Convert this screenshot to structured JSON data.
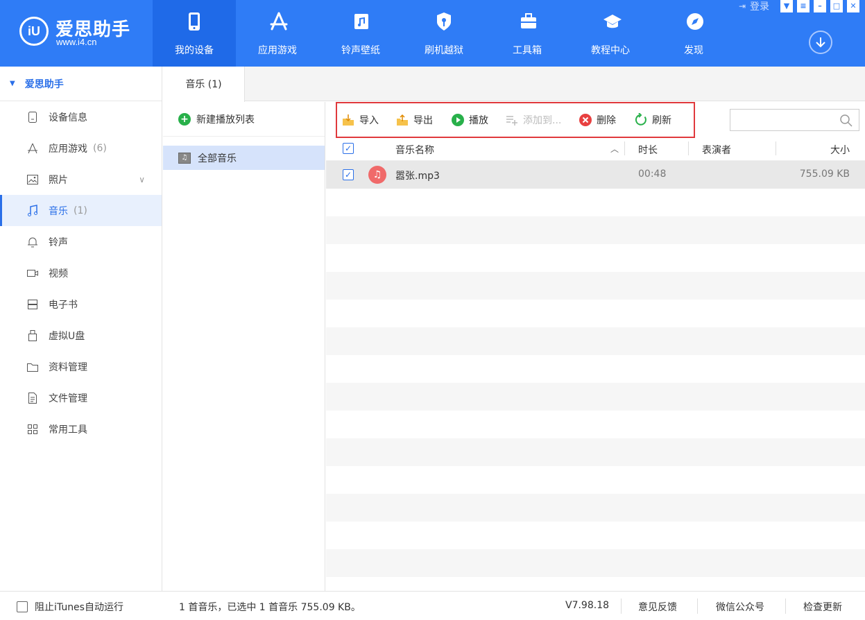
{
  "app": {
    "logo_mark": "iU",
    "logo_name": "爱思助手",
    "logo_url": "www.i4.cn",
    "login_label": "登录"
  },
  "nav": [
    {
      "label": "我的设备",
      "icon": "phone-icon",
      "active": true
    },
    {
      "label": "应用游戏",
      "icon": "app-store-icon"
    },
    {
      "label": "铃声壁纸",
      "icon": "music-file-icon"
    },
    {
      "label": "刷机越狱",
      "icon": "shield-key-icon"
    },
    {
      "label": "工具箱",
      "icon": "toolbox-icon"
    },
    {
      "label": "教程中心",
      "icon": "graduation-cap-icon"
    },
    {
      "label": "发现",
      "icon": "compass-icon"
    }
  ],
  "sidebar": {
    "header": "爱思助手",
    "items": [
      {
        "label": "设备信息",
        "icon": "device-info-icon"
      },
      {
        "label": "应用游戏",
        "count": "(6)",
        "icon": "app-store-icon"
      },
      {
        "label": "照片",
        "icon": "photo-icon"
      },
      {
        "label": "音乐",
        "count": "(1)",
        "icon": "music-note-icon",
        "active": true
      },
      {
        "label": "铃声",
        "icon": "bell-icon"
      },
      {
        "label": "视频",
        "icon": "video-icon"
      },
      {
        "label": "电子书",
        "icon": "book-icon"
      },
      {
        "label": "虚拟U盘",
        "icon": "usb-drive-icon"
      },
      {
        "label": "资料管理",
        "icon": "folder-icon"
      },
      {
        "label": "文件管理",
        "icon": "document-icon"
      },
      {
        "label": "常用工具",
        "icon": "grid-icon"
      }
    ]
  },
  "tabs": {
    "music": "音乐 (1)"
  },
  "playlists": {
    "new_label": "新建播放列表",
    "all_label": "全部音乐"
  },
  "toolbar": {
    "import": "导入",
    "export": "导出",
    "play": "播放",
    "add_to": "添加到...",
    "delete": "删除",
    "refresh": "刷新",
    "search_placeholder": ""
  },
  "table": {
    "headers": {
      "name": "音乐名称",
      "duration": "时长",
      "artist": "表演者",
      "size": "大小"
    },
    "rows": [
      {
        "name": "嚣张.mp3",
        "duration": "00:48",
        "artist": "",
        "size": "755.09 KB",
        "checked": true
      }
    ]
  },
  "status": {
    "itunes_label": "阻止iTunes自动运行",
    "summary": "1 首音乐，已选中 1 首音乐 755.09 KB。",
    "version": "V7.98.18",
    "feedback": "意见反馈",
    "wechat": "微信公众号",
    "update": "检查更新"
  },
  "colors": {
    "brand": "#2f7cf6",
    "accent": "#2a6fe8",
    "highlight_box": "#e0393c"
  }
}
